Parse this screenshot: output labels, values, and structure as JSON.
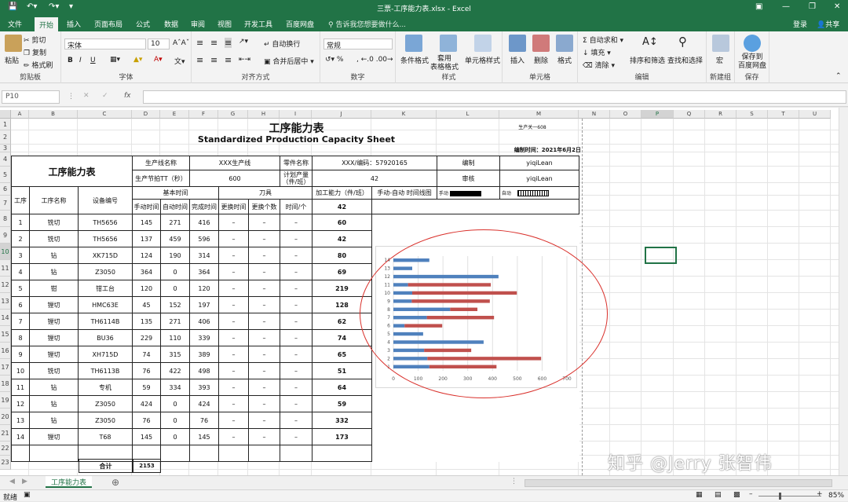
{
  "window": {
    "title": "三票-工序能力表.xlsx - Excel",
    "login": "登录",
    "share": "共享"
  },
  "tabs": [
    "文件",
    "开始",
    "插入",
    "页面布局",
    "公式",
    "数据",
    "审阅",
    "视图",
    "开发工具",
    "百度网盘"
  ],
  "tell_me": "告诉我您想要做什么...",
  "ribbon": {
    "clipboard": {
      "group": "剪贴板",
      "paste": "粘贴",
      "cut": "剪切",
      "copy": "复制",
      "format_painter": "格式刷"
    },
    "font": {
      "group": "字体",
      "name": "宋体",
      "size": "10",
      "bold": "B",
      "italic": "I",
      "underline": "U"
    },
    "alignment": {
      "group": "对齐方式",
      "wrap": "自动换行",
      "merge": "合并后居中"
    },
    "number": {
      "group": "数字",
      "format": "常规"
    },
    "styles": {
      "group": "样式",
      "conditional": "条件格式",
      "table": "套用\n表格格式",
      "cell_styles": "单元格样式"
    },
    "cells": {
      "group": "单元格",
      "insert": "插入",
      "delete": "删除",
      "format": "格式"
    },
    "editing": {
      "group": "编辑",
      "autosum": "自动求和",
      "fill": "填充",
      "clear": "清除",
      "sort": "排序和筛选",
      "find": "查找和选择"
    },
    "macros": {
      "group": "新建组",
      "macro": "宏"
    },
    "save": {
      "group": "保存",
      "label": "保存到\n百度网盘"
    }
  },
  "formula_bar": {
    "name_box": "P10",
    "fx": "fx"
  },
  "columns": [
    "A",
    "B",
    "C",
    "D",
    "E",
    "F",
    "G",
    "H",
    "I",
    "J",
    "K",
    "L",
    "M",
    "N",
    "O",
    "P",
    "Q",
    "R",
    "S",
    "T",
    "U"
  ],
  "rows": [
    "1",
    "2",
    "3",
    "4",
    "5",
    "6",
    "7",
    "8",
    "9",
    "10",
    "11",
    "12",
    "13",
    "14",
    "15",
    "16",
    "17",
    "18",
    "19",
    "20",
    "21",
    "22",
    "23"
  ],
  "sheet": {
    "title_cn": "工序能力表",
    "title_en": "Standardized Production Capacity Sheet",
    "line_code": "生产关一608",
    "date_label": "编制时间：",
    "date": "2021年6月2日",
    "big_title": "工序能力表",
    "line_name_label": "生产线名称",
    "line_name": "XXX生产线",
    "part_label": "零件名称",
    "part_value": "XXX/编码：57920165",
    "editor_label": "编制",
    "editor": "yiqiLean",
    "tt_label": "生产节拍TT（秒）",
    "tt_value": "600",
    "plan_label": "计划产量\n（件/班）",
    "plan_value": "42",
    "review_label": "审核",
    "reviewer": "yiqiLean",
    "h_proc": "工序",
    "h_name": "工序名称",
    "h_equip": "设备编号",
    "h_basic": "基本时间",
    "h_tool": "刀具",
    "h_cap": "加工能力（件/班）",
    "h_chart": "手动-自动 时间线图",
    "legend_manual": "手动",
    "legend_auto": "自动",
    "sub_manual": "手动时间",
    "sub_auto": "自动时间",
    "sub_finish": "完成时间",
    "sub_change": "更换时间",
    "sub_count": "更换个数",
    "sub_pertime": "时间/个",
    "sub_cap_value": "42",
    "rows": [
      {
        "no": "1",
        "name": "铣切",
        "equip": "TH5656",
        "m": "145",
        "a": "271",
        "f": "416",
        "c": "–",
        "n": "–",
        "p": "–",
        "cap": "60"
      },
      {
        "no": "2",
        "name": "铣切",
        "equip": "TH5656",
        "m": "137",
        "a": "459",
        "f": "596",
        "c": "–",
        "n": "–",
        "p": "–",
        "cap": "42"
      },
      {
        "no": "3",
        "name": "钻",
        "equip": "XK715D",
        "m": "124",
        "a": "190",
        "f": "314",
        "c": "–",
        "n": "–",
        "p": "–",
        "cap": "80"
      },
      {
        "no": "4",
        "name": "钻",
        "equip": "Z3050",
        "m": "364",
        "a": "0",
        "f": "364",
        "c": "–",
        "n": "–",
        "p": "–",
        "cap": "69"
      },
      {
        "no": "5",
        "name": "钳",
        "equip": "钳工台",
        "m": "120",
        "a": "0",
        "f": "120",
        "c": "–",
        "n": "–",
        "p": "–",
        "cap": "219"
      },
      {
        "no": "6",
        "name": "镗切",
        "equip": "HMC63E",
        "m": "45",
        "a": "152",
        "f": "197",
        "c": "–",
        "n": "–",
        "p": "–",
        "cap": "128"
      },
      {
        "no": "7",
        "name": "镗切",
        "equip": "TH6114B",
        "m": "135",
        "a": "271",
        "f": "406",
        "c": "–",
        "n": "–",
        "p": "–",
        "cap": "62"
      },
      {
        "no": "8",
        "name": "镗切",
        "equip": "BU36",
        "m": "229",
        "a": "110",
        "f": "339",
        "c": "–",
        "n": "–",
        "p": "–",
        "cap": "74"
      },
      {
        "no": "9",
        "name": "镗切",
        "equip": "XH715D",
        "m": "74",
        "a": "315",
        "f": "389",
        "c": "–",
        "n": "–",
        "p": "–",
        "cap": "65"
      },
      {
        "no": "10",
        "name": "铣切",
        "equip": "TH6113B",
        "m": "76",
        "a": "422",
        "f": "498",
        "c": "–",
        "n": "–",
        "p": "–",
        "cap": "51"
      },
      {
        "no": "11",
        "name": "钻",
        "equip": "专机",
        "m": "59",
        "a": "334",
        "f": "393",
        "c": "–",
        "n": "–",
        "p": "–",
        "cap": "64"
      },
      {
        "no": "12",
        "name": "钻",
        "equip": "Z3050",
        "m": "424",
        "a": "0",
        "f": "424",
        "c": "–",
        "n": "–",
        "p": "–",
        "cap": "59"
      },
      {
        "no": "13",
        "name": "钻",
        "equip": "Z3050",
        "m": "76",
        "a": "0",
        "f": "76",
        "c": "–",
        "n": "–",
        "p": "–",
        "cap": "332"
      },
      {
        "no": "14",
        "name": "镗切",
        "equip": "T68",
        "m": "145",
        "a": "0",
        "f": "145",
        "c": "–",
        "n": "–",
        "p": "–",
        "cap": "173"
      }
    ],
    "total_label": "合计",
    "total_value": "2153"
  },
  "chart_data": {
    "type": "bar",
    "orientation": "horizontal",
    "stacked": true,
    "categories": [
      "1",
      "2",
      "3",
      "4",
      "5",
      "6",
      "7",
      "8",
      "9",
      "10",
      "11",
      "12",
      "13",
      "14"
    ],
    "series": [
      {
        "values": [
          145,
          137,
          124,
          364,
          120,
          45,
          135,
          229,
          74,
          76,
          59,
          424,
          76,
          145
        ],
        "color": "#4f81bd"
      },
      {
        "values": [
          271,
          459,
          190,
          0,
          0,
          152,
          271,
          110,
          315,
          422,
          334,
          0,
          0,
          0
        ],
        "color": "#c0504d"
      }
    ],
    "xlim": [
      0,
      700
    ],
    "xticks": [
      "0",
      "100",
      "200",
      "300",
      "400",
      "500",
      "600",
      "700"
    ],
    "grid": true
  },
  "sheet_tabs": {
    "active": "工序能力表"
  },
  "status": {
    "ready": "就绪",
    "zoom": "85%"
  },
  "watermark": "知乎 @Jerry 张智伟"
}
